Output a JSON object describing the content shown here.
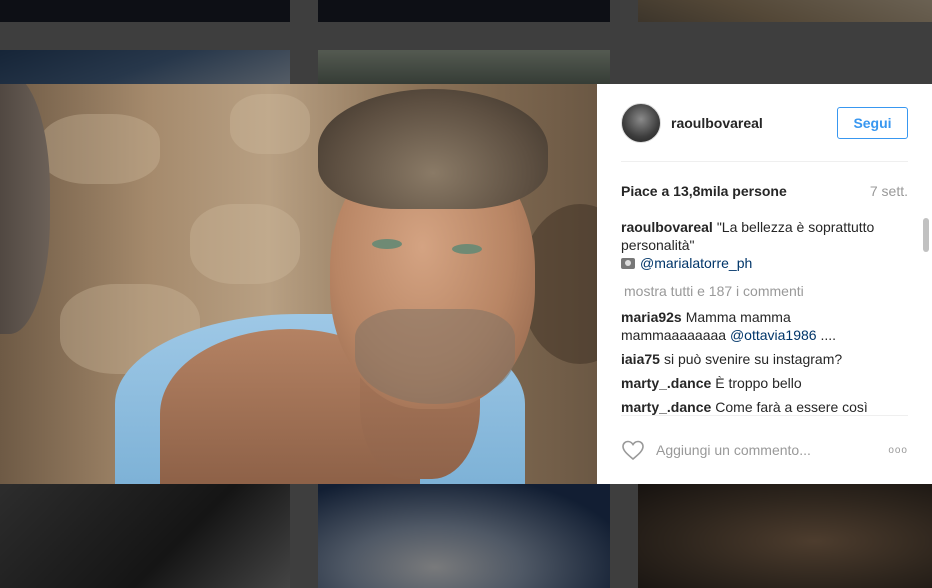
{
  "post": {
    "username": "raoulbovareal",
    "follow_label": "Segui",
    "likes": "Piace a 13,8mila persone",
    "time": "7 sett.",
    "caption": {
      "user": "raoulbovareal",
      "text": "\"La bellezza è soprattutto personalità\"",
      "mention": "@marialatorre_ph"
    },
    "show_all": "mostra tutti e 187 i commenti",
    "comments": [
      {
        "user": "maria92s",
        "text": "Mamma mamma mammaaaaaaaa",
        "mention": "@ottavia1986",
        "tail": " ...."
      },
      {
        "user": "iaia75",
        "text": "si può svenire su instagram?",
        "mention": "",
        "tail": ""
      },
      {
        "user": "marty_.dance",
        "text": "È troppo bello",
        "mention": "",
        "tail": ""
      },
      {
        "user": "marty_.dance",
        "text": "Come farà a essere così",
        "mention": "",
        "tail": ""
      }
    ],
    "comment_placeholder": "Aggiungi un commento...",
    "more_label": "ooo"
  },
  "colors": {
    "accent": "#3897f0",
    "text": "#262626",
    "muted": "#999999",
    "mention": "#003569"
  },
  "icons": {
    "heart": "heart-icon",
    "camera": "camera-icon",
    "more": "more-options-icon"
  }
}
